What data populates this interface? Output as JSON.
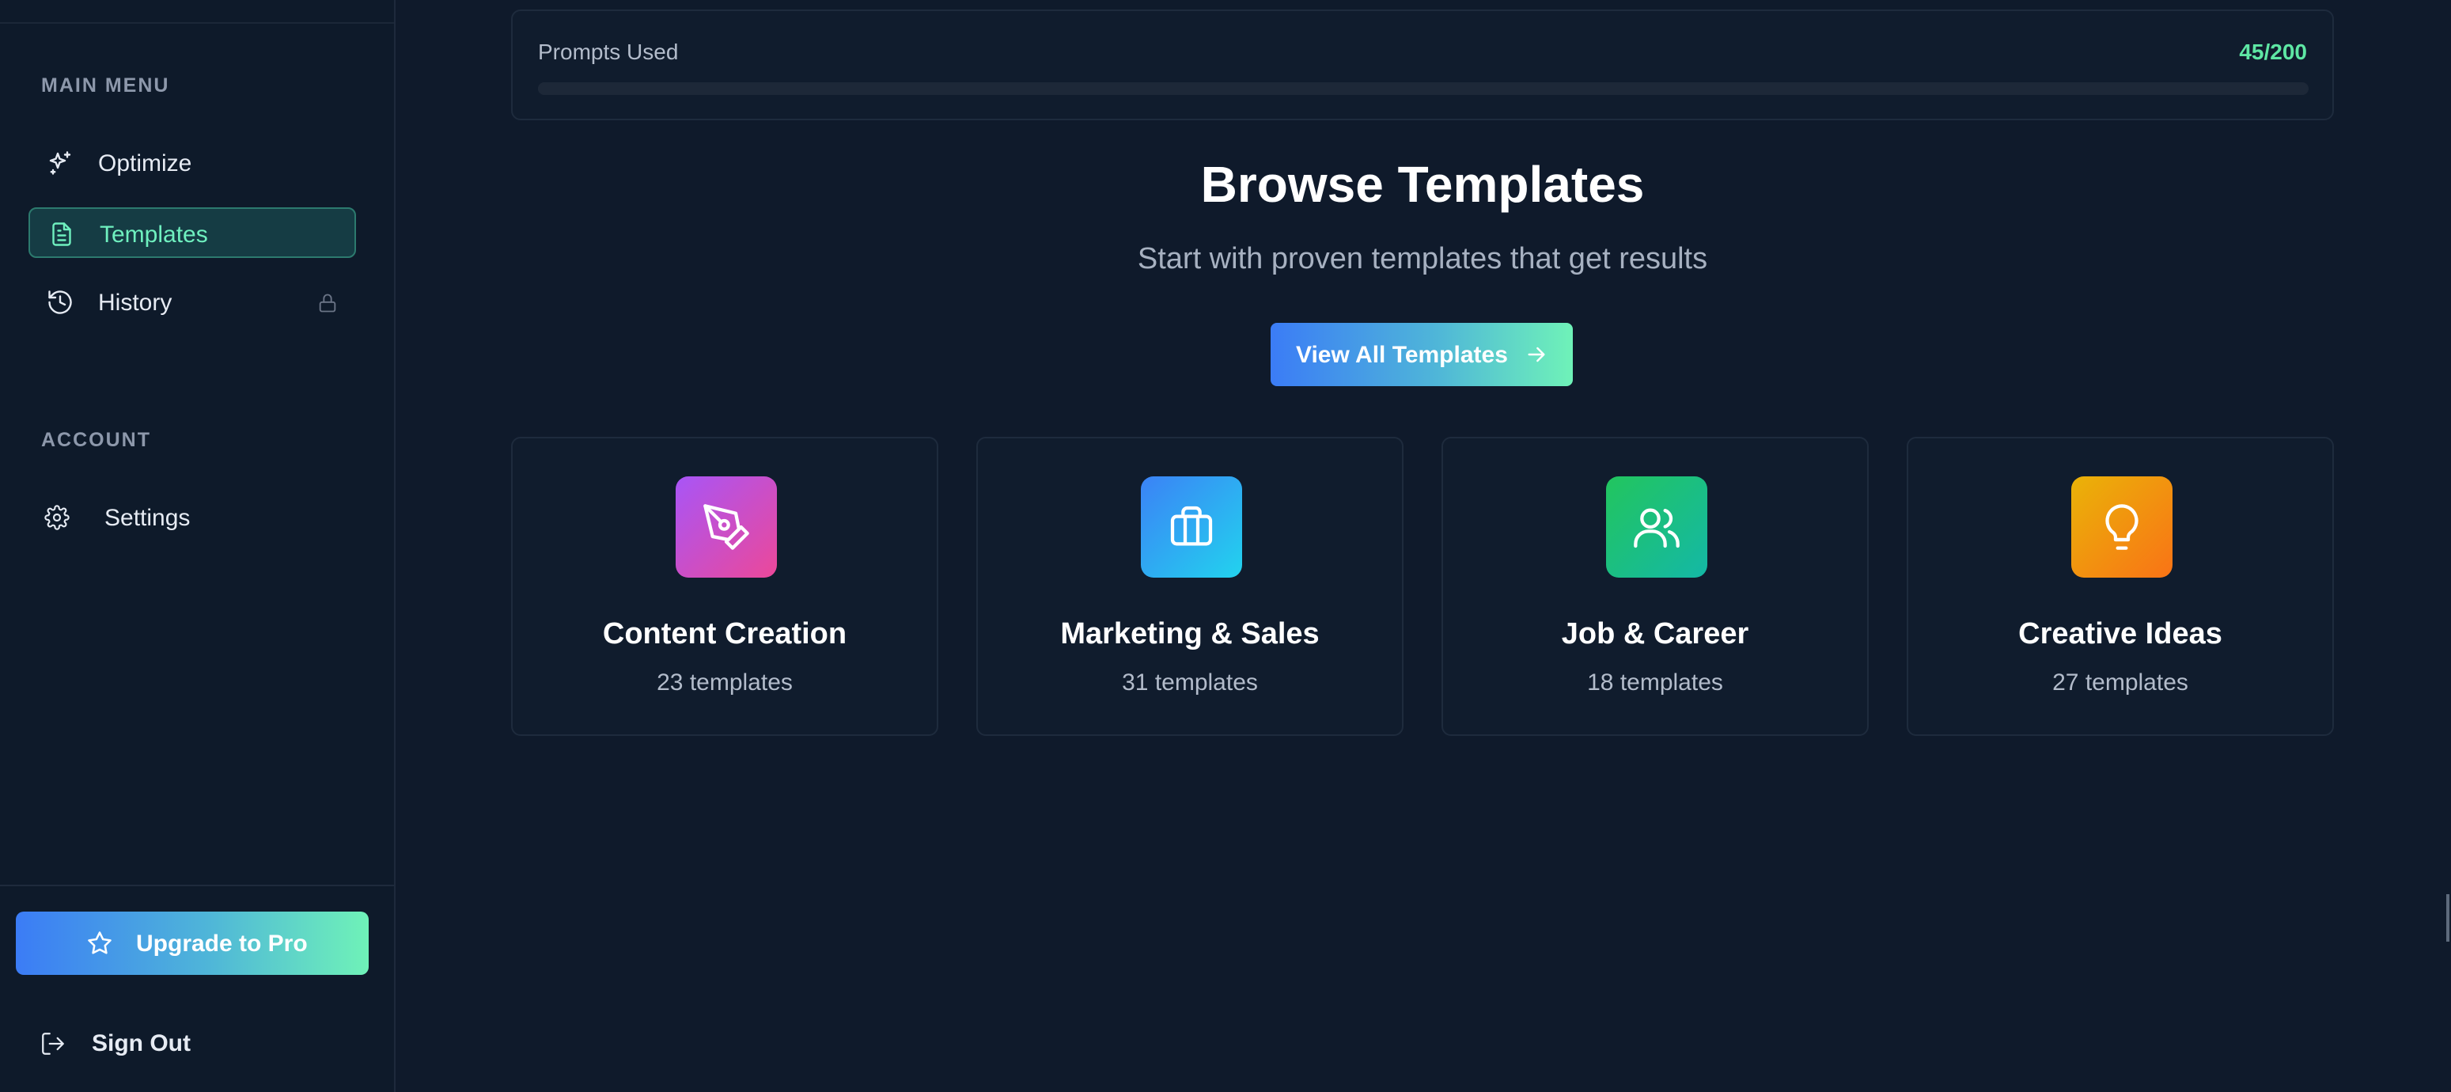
{
  "sidebar": {
    "main_menu_label": "MAIN MENU",
    "account_label": "ACCOUNT",
    "items": [
      {
        "label": "Optimize",
        "icon": "sparkle-icon"
      },
      {
        "label": "Templates",
        "icon": "document-icon",
        "active": true
      },
      {
        "label": "History",
        "icon": "history-icon",
        "locked": true
      }
    ],
    "account_items": [
      {
        "label": "Settings",
        "icon": "gear-icon"
      }
    ],
    "upgrade_label": "Upgrade to Pro",
    "signout_label": "Sign Out"
  },
  "usage": {
    "title": "Prompts Used",
    "count_label": "45/200",
    "used": 45,
    "limit": 200
  },
  "hero": {
    "title": "Browse Templates",
    "subtitle": "Start with proven templates that get results",
    "button_label": "View All Templates"
  },
  "categories": [
    {
      "name": "Content Creation",
      "count": "23 templates",
      "icon": "pen-tool-icon",
      "colors": [
        "#a855f7",
        "#ec4899"
      ]
    },
    {
      "name": "Marketing & Sales",
      "count": "31 templates",
      "icon": "briefcase-icon",
      "colors": [
        "#3b82f6",
        "#22d3ee"
      ]
    },
    {
      "name": "Job & Career",
      "count": "18 templates",
      "icon": "users-icon",
      "colors": [
        "#22c55e",
        "#14b8a6"
      ]
    },
    {
      "name": "Creative Ideas",
      "count": "27 templates",
      "icon": "lightbulb-icon",
      "colors": [
        "#eab308",
        "#f97316"
      ]
    }
  ],
  "colors": {
    "background": "#0f1a2b",
    "accent_green": "#5ee7a4",
    "accent_blue": "#3b7cf6"
  }
}
